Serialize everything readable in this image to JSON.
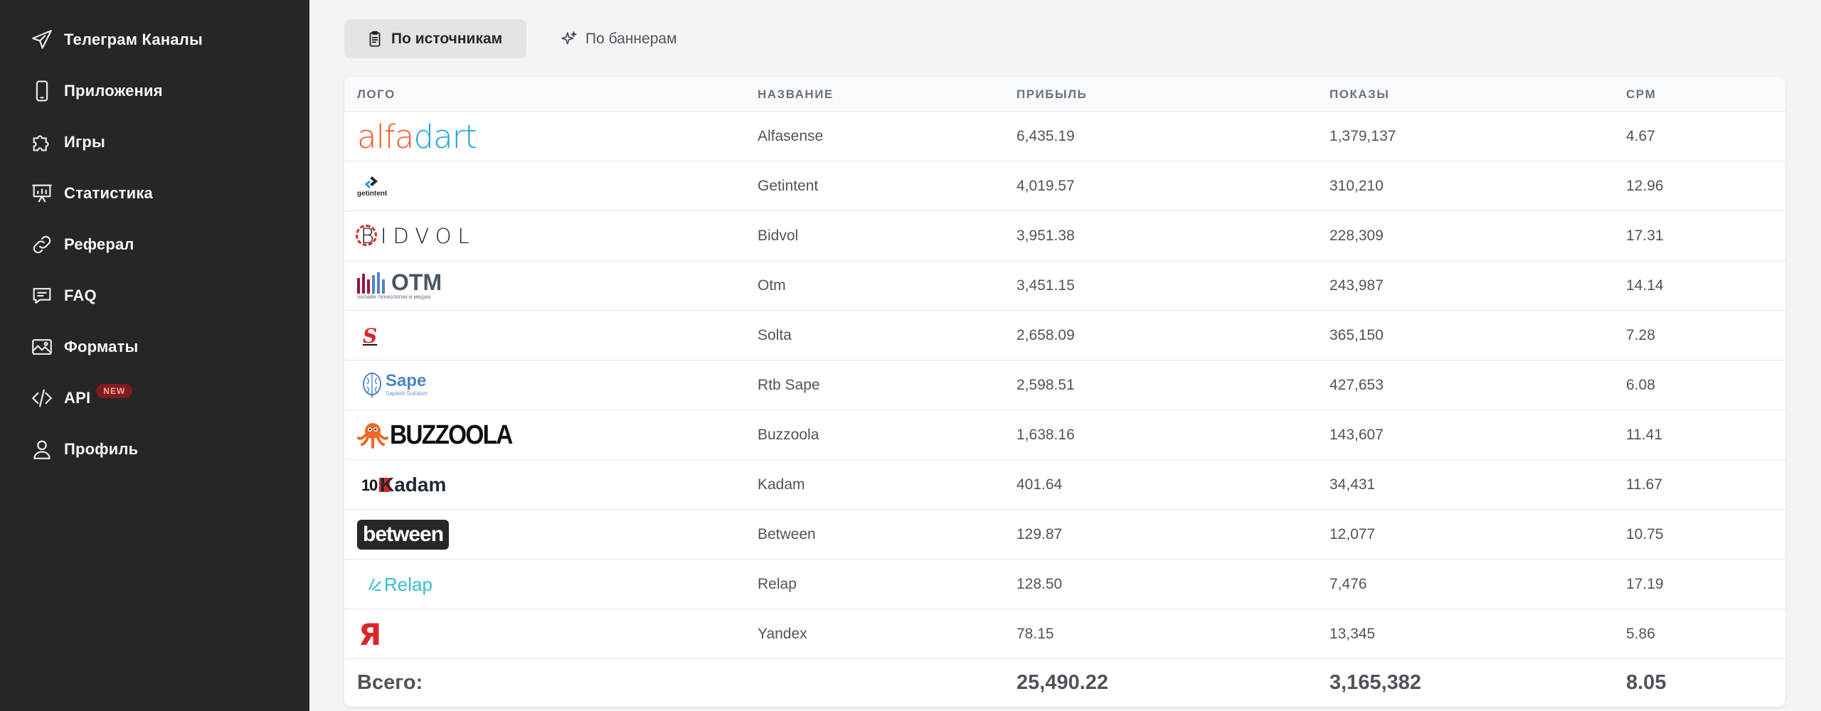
{
  "sidebar": {
    "items": [
      {
        "label": "Телеграм Каналы",
        "icon": "send-icon"
      },
      {
        "label": "Приложения",
        "icon": "smartphone-icon"
      },
      {
        "label": "Игры",
        "icon": "puzzle-icon"
      },
      {
        "label": "Статистика",
        "icon": "presentation-chart-icon"
      },
      {
        "label": "Реферал",
        "icon": "link-icon"
      },
      {
        "label": "FAQ",
        "icon": "chat-bubble-icon"
      },
      {
        "label": "Форматы",
        "icon": "image-icon"
      },
      {
        "label": "API",
        "icon": "code-icon",
        "badge": "NEW"
      },
      {
        "label": "Профиль",
        "icon": "user-icon"
      }
    ]
  },
  "tabs": [
    {
      "label": "По источникам",
      "icon": "clipboard-icon",
      "active": true
    },
    {
      "label": "По баннерам",
      "icon": "sparkles-icon",
      "active": false
    }
  ],
  "table": {
    "headers": [
      "ЛОГО",
      "НАЗВАНИЕ",
      "ПРИБЫЛЬ",
      "ПОКАЗЫ",
      "CPM"
    ],
    "rows": [
      {
        "logo": "alfadart",
        "name": "Alfasense",
        "profit": "6,435.19",
        "impressions": "1,379,137",
        "cpm": "4.67"
      },
      {
        "logo": "getintent",
        "name": "Getintent",
        "profit": "4,019.57",
        "impressions": "310,210",
        "cpm": "12.96"
      },
      {
        "logo": "BIDVOL",
        "name": "Bidvol",
        "profit": "3,951.38",
        "impressions": "228,309",
        "cpm": "17.31"
      },
      {
        "logo": "OTM",
        "logo_sub": "онлайн технологии и медиа",
        "name": "Otm",
        "profit": "3,451.15",
        "impressions": "243,987",
        "cpm": "14.14"
      },
      {
        "logo": "S",
        "name": "Solta",
        "profit": "2,658.09",
        "impressions": "365,150",
        "cpm": "7.28"
      },
      {
        "logo": "Sape",
        "logo_sub": "Sapient Solution",
        "name": "Rtb Sape",
        "profit": "2,598.51",
        "impressions": "427,653",
        "cpm": "6.08"
      },
      {
        "logo": "BUZZOOLA",
        "name": "Buzzoola",
        "profit": "1,638.16",
        "impressions": "143,607",
        "cpm": "11.41"
      },
      {
        "logo": "Kadam",
        "name": "Kadam",
        "profit": "401.64",
        "impressions": "34,431",
        "cpm": "11.67"
      },
      {
        "logo": "between",
        "name": "Between",
        "profit": "129.87",
        "impressions": "12,077",
        "cpm": "10.75"
      },
      {
        "logo": "Relap",
        "name": "Relap",
        "profit": "128.50",
        "impressions": "7,476",
        "cpm": "17.19"
      },
      {
        "logo": "Я",
        "name": "Yandex",
        "profit": "78.15",
        "impressions": "13,345",
        "cpm": "5.86"
      }
    ],
    "total": {
      "label": "Всего:",
      "profit": "25,490.22",
      "impressions": "3,165,382",
      "cpm": "8.05"
    }
  },
  "colors": {
    "sidebar": "#262626",
    "page": "#f3f4f6",
    "alfadart_orange": "#f05a28",
    "alfadart_blue": "#1aa3d9",
    "new_badge": "#7f1d1d"
  }
}
